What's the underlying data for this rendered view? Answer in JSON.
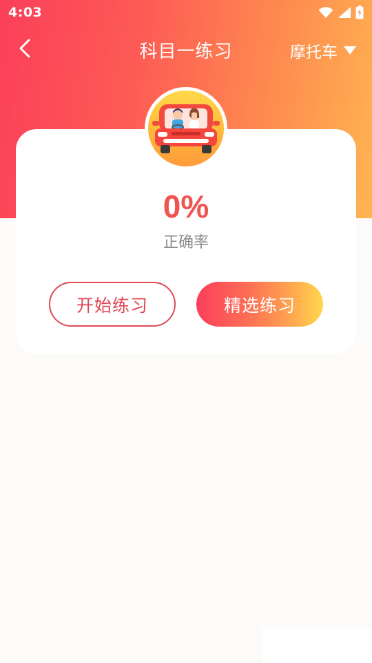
{
  "status_bar": {
    "time": "4:03",
    "icons": [
      "wifi-icon",
      "signal-icon",
      "battery-charging-icon"
    ]
  },
  "nav": {
    "back_icon": "chevron-left-icon",
    "title": "科目一练习",
    "vehicle_type": "摩托车",
    "dropdown_icon": "caret-down-icon"
  },
  "stats": {
    "accuracy_value": "0%",
    "accuracy_label": "正确率",
    "avatar_icon": "car-with-passengers-illustration"
  },
  "actions": {
    "start_label": "开始练习",
    "selected_label": "精选练习"
  },
  "colors": {
    "gradient_start": "#fb3f5a",
    "gradient_end": "#ffb452",
    "accent_red": "#f0544f",
    "outline_red": "#e04856",
    "muted_text": "#8a8a8a",
    "page_bg": "#fcfbf9"
  }
}
